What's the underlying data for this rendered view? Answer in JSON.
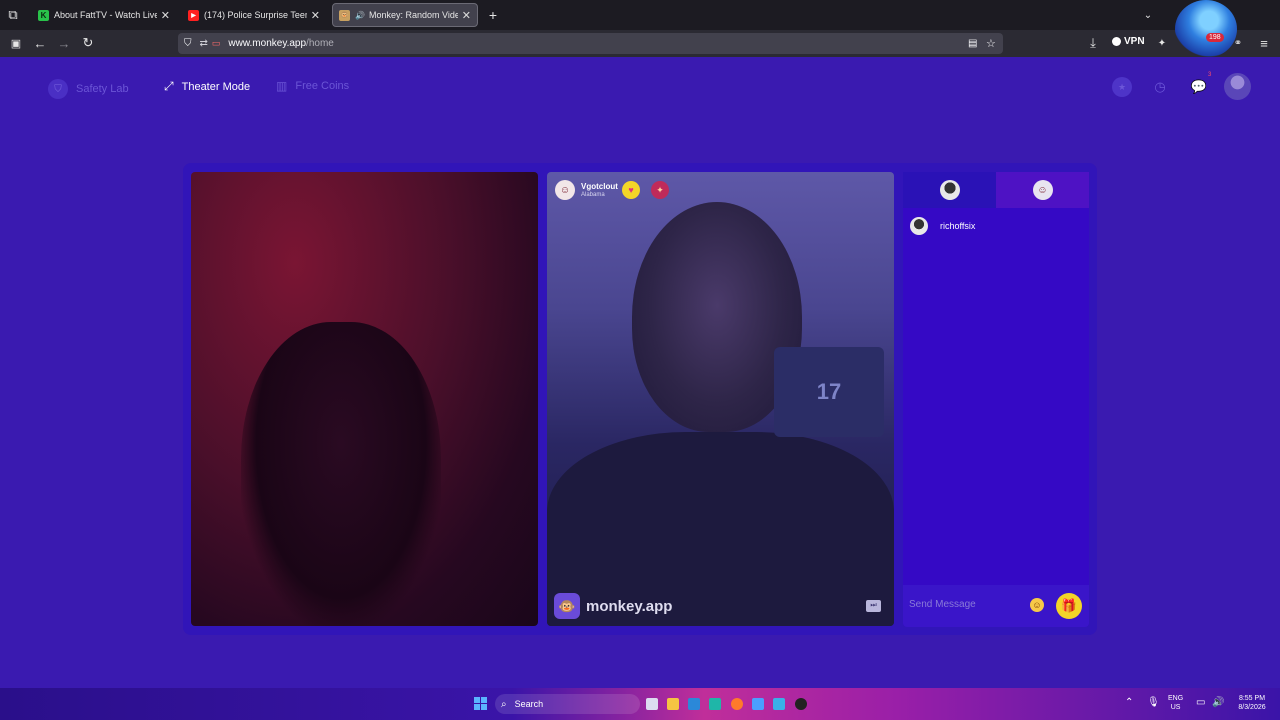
{
  "browser": {
    "tabs": [
      {
        "title": "About FattTV - Watch Live on K",
        "favicon": "K"
      },
      {
        "title": "(174) Police Surprise Teens Mir",
        "favicon": "▶"
      },
      {
        "title": "Monkey: Random Video Ch",
        "favicon": "🐵",
        "active": true
      }
    ],
    "url_host": "www.monkey.app",
    "url_path": "/home",
    "vpn_label": "VPN",
    "extension_badge": "198"
  },
  "header": {
    "safety_lab": "Safety Lab",
    "theater_mode": "Theater Mode",
    "free_coins": "Free Coins",
    "chat_badge": "3"
  },
  "remote_user": {
    "name": "Vgotclout",
    "location": "Alabama",
    "jersey_number": "17"
  },
  "watermark": "monkey.app",
  "chat": {
    "messages": [
      {
        "user": "richoffsix"
      }
    ],
    "placeholder": "Send Message"
  },
  "taskbar": {
    "search": "Search",
    "lang_top": "ENG",
    "lang_bottom": "US",
    "time": "8:55 PM",
    "date": "8/3/2026"
  },
  "colors": {
    "page_bg": "#3a1ab0",
    "stage_bg": "#3115b8",
    "chat_bg": "#3509c5",
    "gift_yellow": "#f3d528"
  }
}
